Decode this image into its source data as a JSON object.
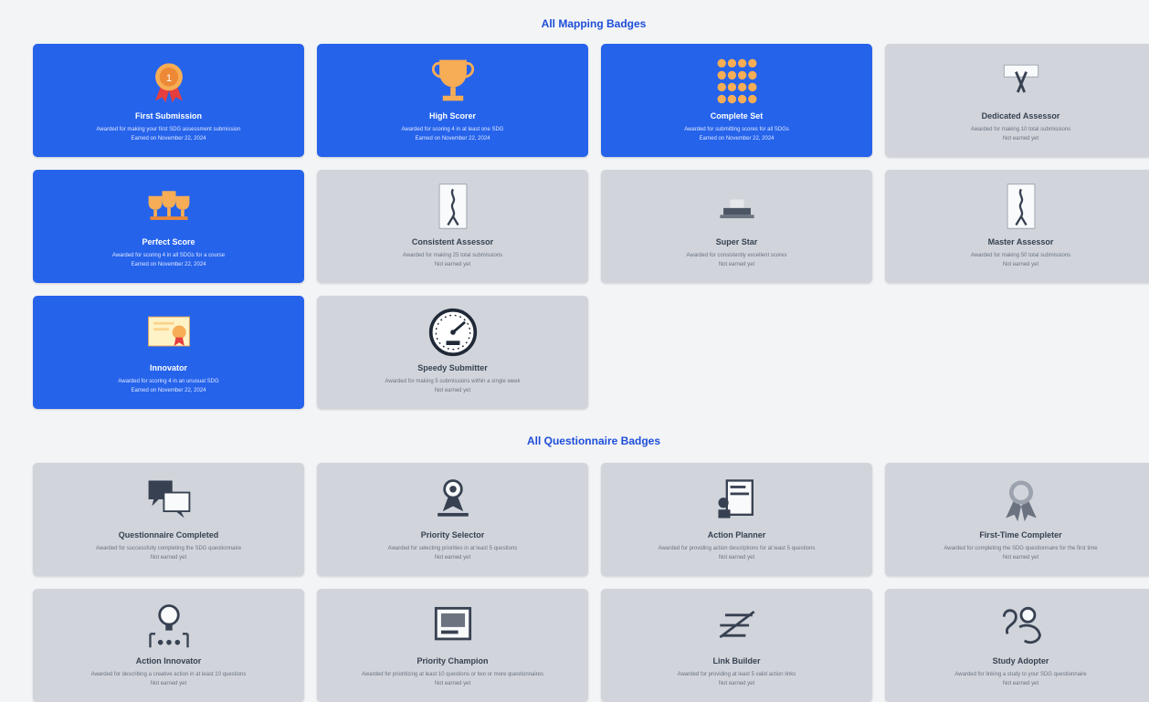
{
  "mapping": {
    "title": "All Mapping Badges",
    "badges": [
      {
        "name": "First Submission",
        "desc": "Awarded for making your first SDG assessment submission",
        "date": "Earned on November 22, 2024",
        "earned": true,
        "icon": "medal-icon"
      },
      {
        "name": "High Scorer",
        "desc": "Awarded for scoring 4 in at least one SDG",
        "date": "Earned on November 22, 2024",
        "earned": true,
        "icon": "trophy-icon"
      },
      {
        "name": "Complete Set",
        "desc": "Awarded for submitting scores for all SDGs",
        "date": "Earned on November 22, 2024",
        "earned": true,
        "icon": "dots-grid-icon"
      },
      {
        "name": "Dedicated Assessor",
        "desc": "Awarded for making 10 total submissions",
        "date": "Not earned yet",
        "earned": false,
        "icon": "ribbon-icon"
      },
      {
        "name": "Perfect Score",
        "desc": "Awarded for scoring 4 in all SDGs for a course",
        "date": "Earned on November 22, 2024",
        "earned": true,
        "icon": "trophies-icon"
      },
      {
        "name": "Consistent Assessor",
        "desc": "Awarded for making 25 total submissions",
        "date": "Not earned yet",
        "earned": false,
        "icon": "scroll-icon"
      },
      {
        "name": "Super Star",
        "desc": "Awarded for consistently excellent scores",
        "date": "Not earned yet",
        "earned": false,
        "icon": "podium-icon"
      },
      {
        "name": "Master Assessor",
        "desc": "Awarded for making 50 total submissions",
        "date": "Not earned yet",
        "earned": false,
        "icon": "scroll-icon"
      },
      {
        "name": "Innovator",
        "desc": "Awarded for scoring 4 in an unusual SDG",
        "date": "Earned on November 22, 2024",
        "earned": true,
        "icon": "certificate-icon"
      },
      {
        "name": "Speedy Submitter",
        "desc": "Awarded for making 5 submissions within a single week",
        "date": "Not earned yet",
        "earned": false,
        "icon": "speedometer-icon"
      }
    ]
  },
  "questionnaire": {
    "title": "All Questionnaire Badges",
    "badges": [
      {
        "name": "Questionnaire Completed",
        "desc": "Awarded for successfully completing the SDG questionnaire",
        "date": "Not earned yet",
        "earned": false,
        "icon": "chat-icon"
      },
      {
        "name": "Priority Selector",
        "desc": "Awarded for selecting priorities in at least 5 questions",
        "date": "Not earned yet",
        "earned": false,
        "icon": "person-award-icon"
      },
      {
        "name": "Action Planner",
        "desc": "Awarded for providing action descriptions for at least 5 questions",
        "date": "Not earned yet",
        "earned": false,
        "icon": "planner-icon"
      },
      {
        "name": "First-Time Completer",
        "desc": "Awarded for completing the SDG questionnaire for the first time",
        "date": "Not earned yet",
        "earned": false,
        "icon": "rosette-icon"
      },
      {
        "name": "Action Innovator",
        "desc": "Awarded for describing a creative action in at least 10 questions",
        "date": "Not earned yet",
        "earned": false,
        "icon": "lightbulb-icon"
      },
      {
        "name": "Priority Champion",
        "desc": "Awarded for prioritizing at least 10 questions or two or more questionnaires",
        "date": "Not earned yet",
        "earned": false,
        "icon": "monitor-icon"
      },
      {
        "name": "Link Builder",
        "desc": "Awarded for providing at least 5 valid action links",
        "date": "Not earned yet",
        "earned": false,
        "icon": "link-icon"
      },
      {
        "name": "Study Adopter",
        "desc": "Awarded for linking a study to your SDG questionnaire",
        "date": "Not earned yet",
        "earned": false,
        "icon": "study-icon"
      }
    ]
  }
}
